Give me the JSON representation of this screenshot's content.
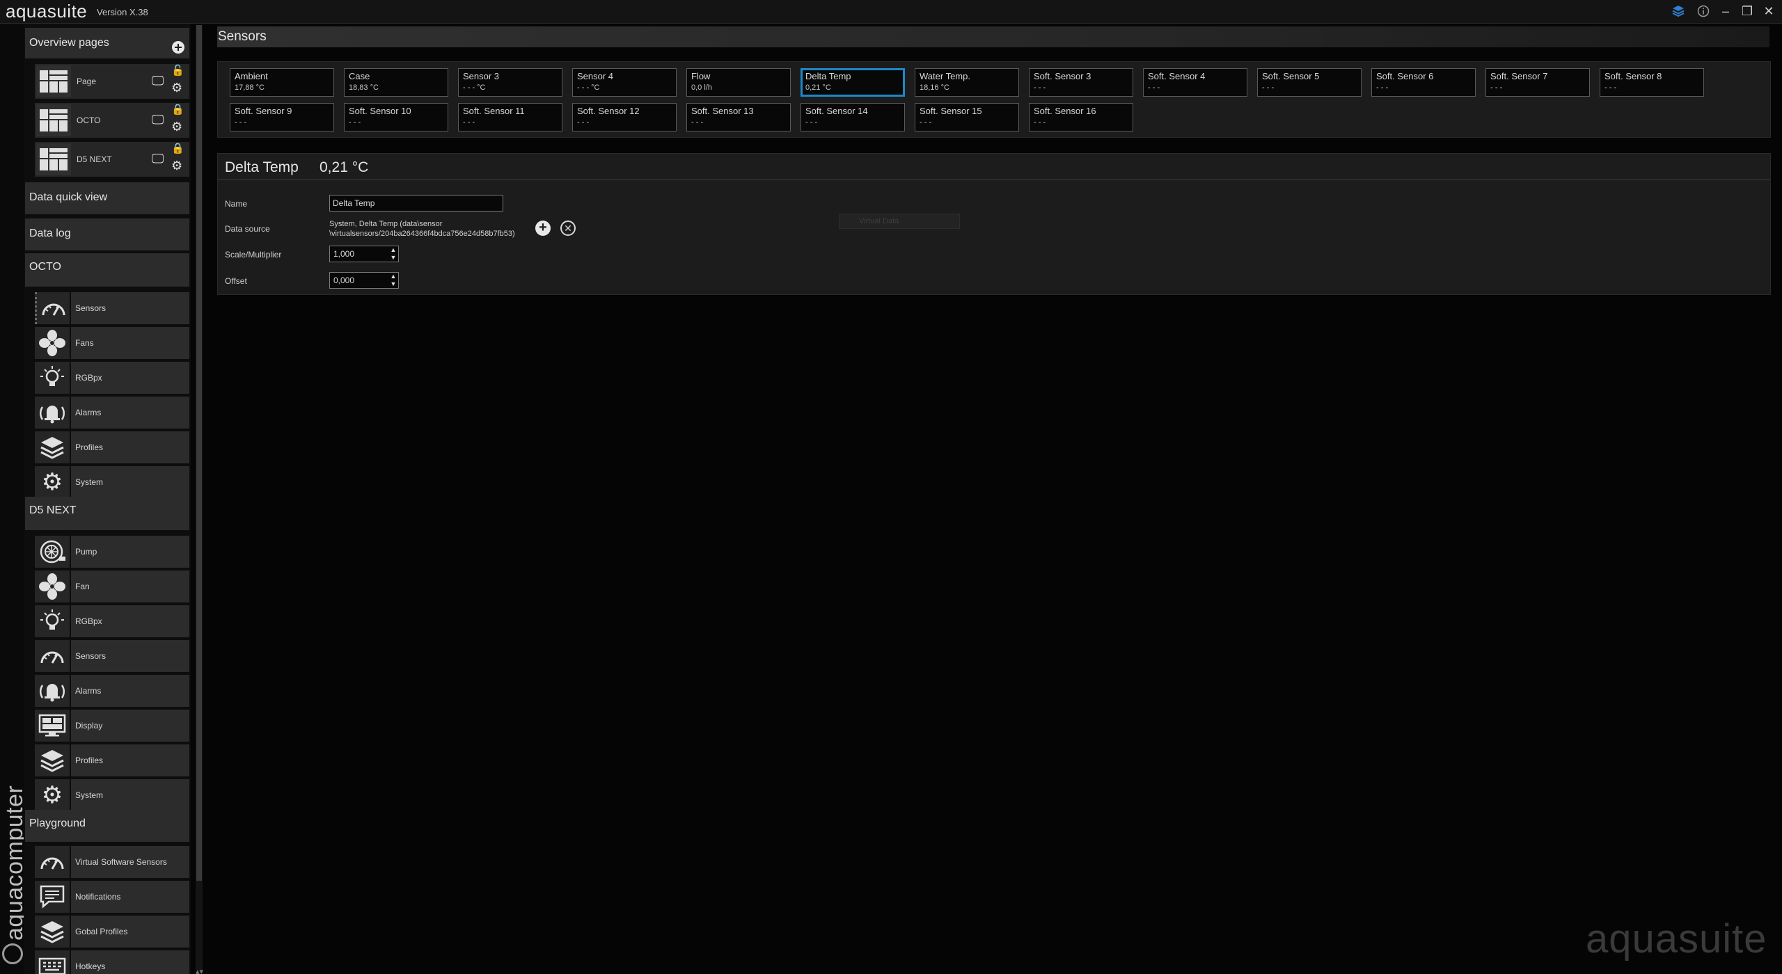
{
  "app": {
    "title": "aquasuite",
    "version": "Version X.38",
    "vertical_brand": "aquacomputer",
    "watermark": "aquasuite"
  },
  "window_controls": {
    "layers_icon": "layers-icon",
    "info_icon": "info-icon",
    "minimize_glyph": "–",
    "restore_glyph": "❐",
    "close_glyph": "✕"
  },
  "sidebar": {
    "overview_header": "Overview pages",
    "overview_pages": [
      {
        "label": "Page",
        "locked": false
      },
      {
        "label": "OCTO",
        "locked": true
      },
      {
        "label": "D5 NEXT",
        "locked": true
      }
    ],
    "data_quick_view": "Data quick view",
    "data_log": "Data log",
    "octo_section": "OCTO",
    "octo_items": [
      {
        "label": "Sensors",
        "icon": "gauge-icon"
      },
      {
        "label": "Fans",
        "icon": "fan-icon"
      },
      {
        "label": "RGBpx",
        "icon": "bulb-icon"
      },
      {
        "label": "Alarms",
        "icon": "alarm-bell-icon"
      },
      {
        "label": "Profiles",
        "icon": "layers-icon"
      },
      {
        "label": "System",
        "icon": "gear-icon"
      }
    ],
    "d5_section": "D5 NEXT",
    "d5_items": [
      {
        "label": "Pump",
        "icon": "pump-icon"
      },
      {
        "label": "Fan",
        "icon": "fan-icon"
      },
      {
        "label": "RGBpx",
        "icon": "bulb-icon"
      },
      {
        "label": "Sensors",
        "icon": "gauge-icon"
      },
      {
        "label": "Alarms",
        "icon": "alarm-bell-icon"
      },
      {
        "label": "Display",
        "icon": "display-icon"
      },
      {
        "label": "Profiles",
        "icon": "layers-icon"
      },
      {
        "label": "System",
        "icon": "gear-icon"
      }
    ],
    "playground_section": "Playground",
    "playground_items": [
      {
        "label": "Virtual Software Sensors",
        "icon": "gauge-icon"
      },
      {
        "label": "Notifications",
        "icon": "message-icon"
      },
      {
        "label": "Gobal Profiles",
        "icon": "layers-icon"
      },
      {
        "label": "Hotkeys",
        "icon": "keyboard-icon"
      }
    ]
  },
  "main": {
    "title": "Sensors",
    "sensors": [
      {
        "name": "Ambient",
        "value": "17,88 °C"
      },
      {
        "name": "Case",
        "value": "18,83 °C"
      },
      {
        "name": "Sensor 3",
        "value": "- - - °C"
      },
      {
        "name": "Sensor 4",
        "value": "- - - °C"
      },
      {
        "name": "Flow",
        "value": "0,0 l/h"
      },
      {
        "name": "Delta Temp",
        "value": "0,21 °C",
        "selected": true
      },
      {
        "name": "Water Temp.",
        "value": "18,16 °C"
      },
      {
        "name": "Soft. Sensor 3",
        "value": "- - -"
      },
      {
        "name": "Soft. Sensor 4",
        "value": "- - -"
      },
      {
        "name": "Soft. Sensor 5",
        "value": "- - -"
      },
      {
        "name": "Soft. Sensor 6",
        "value": "- - -"
      },
      {
        "name": "Soft. Sensor 7",
        "value": "- - -"
      },
      {
        "name": "Soft. Sensor 8",
        "value": "- - -"
      },
      {
        "name": "Soft. Sensor 9",
        "value": "- - -"
      },
      {
        "name": "Soft. Sensor 10",
        "value": "- - -"
      },
      {
        "name": "Soft. Sensor 11",
        "value": "- - -"
      },
      {
        "name": "Soft. Sensor 12",
        "value": "- - -"
      },
      {
        "name": "Soft. Sensor 13",
        "value": "- - -"
      },
      {
        "name": "Soft. Sensor 14",
        "value": "- - -"
      },
      {
        "name": "Soft. Sensor 15",
        "value": "- - -"
      },
      {
        "name": "Soft. Sensor 16",
        "value": "- - -"
      }
    ],
    "detail": {
      "name": "Delta Temp",
      "value": "0,21 °C",
      "name_label": "Name",
      "name_value": "Delta Temp",
      "data_source_label": "Data source",
      "data_source_line1": "System, Delta Temp (data\\sensor",
      "data_source_line2": "\\virtualsensors/204ba264366f4bdca756e24d58b7fb53)",
      "scale_label": "Scale/Multiplier",
      "scale_value": "1,000",
      "offset_label": "Offset",
      "offset_value": "0,000",
      "ghost_tooltip": "Virtual Data"
    }
  },
  "colors": {
    "selected_border": "#1e88c8",
    "unlocked_lock": "#e8a000",
    "background": "#050505",
    "panel": "#1c1c1c"
  }
}
